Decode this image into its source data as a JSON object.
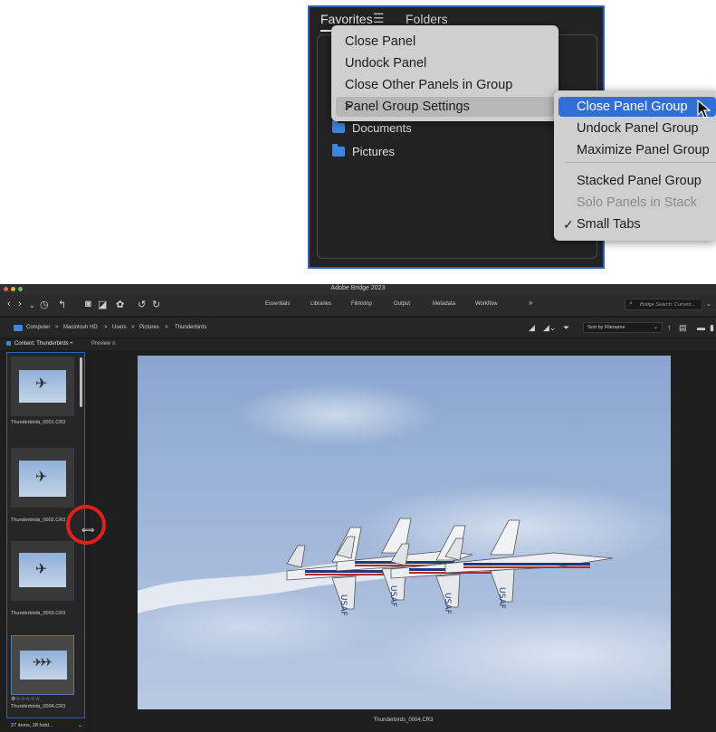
{
  "inset": {
    "tab_favorites": "Favorites",
    "tab_menu_glyph": "☰",
    "tab_folders": "Folders",
    "favorites": [
      "Documents",
      "Pictures"
    ],
    "context_menu": [
      "Close Panel",
      "Undock Panel",
      "Close Other Panels in Group",
      "Panel Group Settings"
    ],
    "submenu_chevron": ">",
    "submenu": [
      {
        "label": "Close Panel Group",
        "state": "highlighted"
      },
      {
        "label": "Undock Panel Group",
        "state": "enabled"
      },
      {
        "label": "Maximize Panel Group",
        "state": "enabled"
      },
      {
        "label": "Stacked Panel Group",
        "state": "enabled"
      },
      {
        "label": "Solo Panels in Stack",
        "state": "disabled"
      },
      {
        "label": "Small Tabs",
        "state": "checked"
      }
    ],
    "check_glyph": "✓"
  },
  "window": {
    "title": "Adobe Bridge 2023",
    "workspaces": [
      "Essentials",
      "Libraries",
      "Filmstrip",
      "Output",
      "Metadata",
      "Workflow",
      "»"
    ],
    "search_placeholder": "Bridge Search: Current...",
    "breadcrumb": [
      "Computer",
      ">",
      "Macintosh HD",
      ">",
      "Users",
      ">",
      "Pictures",
      ">",
      "Thunderbirds"
    ],
    "sort_label": "Sort by Filename",
    "content_tab": "Content: Thunderbirds",
    "content_tab_add": "+",
    "preview_tab": "Preview",
    "preview_tab_menu": "≡",
    "thumbnails": [
      "Thunderbirds_0001.CR3",
      "Thunderbirds_0002.CR3",
      "Thunderbirds_0003.CR3",
      "Thunderbirds_0004.CR3"
    ],
    "rating_stars": "⚙☆☆☆☆☆",
    "status_text": "27 items, 28 hidd...",
    "preview_caption": "Thunderbirds_0004.CR3",
    "photo_plane_markings": [
      "USAF",
      "USAF",
      "USAF",
      "USAF"
    ]
  },
  "colors": {
    "accent_blue": "#2f6fd6",
    "folder_blue": "#3b86e0",
    "highlight_red": "#e2201b"
  }
}
